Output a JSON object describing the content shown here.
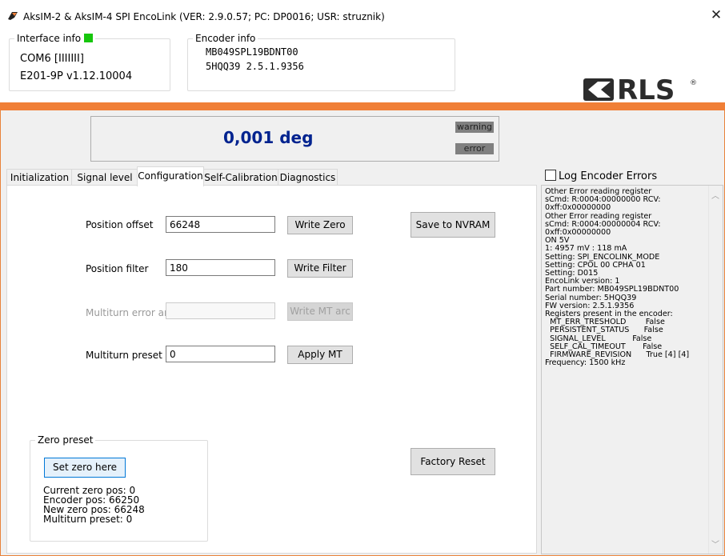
{
  "window": {
    "title": "AksIM-2 & AksIM-4 SPI EncoLink (VER: 2.9.0.57; PC: DP0016; USR: struznik)",
    "close_glyph": "✕"
  },
  "interface_info": {
    "legend": "Interface info",
    "port": "COM6  [IIIIIII]",
    "device": "E201-9P v1.12.10004",
    "status_color": "#16c60c"
  },
  "encoder_info": {
    "legend": "Encoder info",
    "part": "MB049SPL19BDNT00",
    "serial_fw": "5HQQ39   2.5.1.9356"
  },
  "logo": {
    "text": "RLS",
    "mark": "®"
  },
  "display": {
    "value": "0,001 deg",
    "warning_label": "warning",
    "error_label": "error"
  },
  "tabs": [
    {
      "label": "Initialization"
    },
    {
      "label": "Signal level"
    },
    {
      "label": "Configuration",
      "active": true
    },
    {
      "label": "Self-Calibration"
    },
    {
      "label": "Diagnostics"
    }
  ],
  "config": {
    "position_offset": {
      "label": "Position offset",
      "value": "66248",
      "button": "Write Zero"
    },
    "position_filter": {
      "label": "Position filter",
      "value": "180",
      "button": "Write Filter"
    },
    "multiturn_error_arc": {
      "label": "Multiturn error arc",
      "value": "",
      "button": "Write MT arc"
    },
    "multiturn_preset": {
      "label": "Multiturn preset",
      "value": "0",
      "button": "Apply MT"
    },
    "save_nvram": "Save to NVRAM",
    "factory_reset": "Factory Reset"
  },
  "zero_preset": {
    "legend": "Zero preset",
    "button": "Set zero here",
    "current_zero": "Current zero pos: 0",
    "encoder_pos": "Encoder pos: 66250",
    "new_zero": "New zero pos: 66248",
    "multiturn_preset": "Multiturn preset: 0"
  },
  "log": {
    "checkbox_label": "Log Encoder Errors",
    "text": "Other Error reading register\nsCmd: R:0004:00000000 RCV:\n0xff:0x00000000\nOther Error reading register\nsCmd: R:0004:00000004 RCV:\n0xff:0x00000000\nON 5V\n1: 4957 mV : 118 mA\nSetting: SPI_ENCOLINK_MODE\nSetting: CPOL 00 CPHA 01\nSetting: D015\nEncoLink version: 1\nPart number: MB049SPL19BDNT00\nSerial number: 5HQQ39\nFW version: 2.5.1.9356\nRegisters present in the encoder:\n  MT_ERR_TRESHOLD        False\n  PERSISTENT_STATUS      False\n  SIGNAL_LEVEL           False\n  SELF_CAL_TIMEOUT       False\n  FIRMWARE_REVISION      True [4] [4]\nFrequency: 1500 kHz"
  },
  "colors": {
    "accent_orange": "#f07f37",
    "value_blue": "#00238f",
    "led_green": "#16c60c"
  }
}
